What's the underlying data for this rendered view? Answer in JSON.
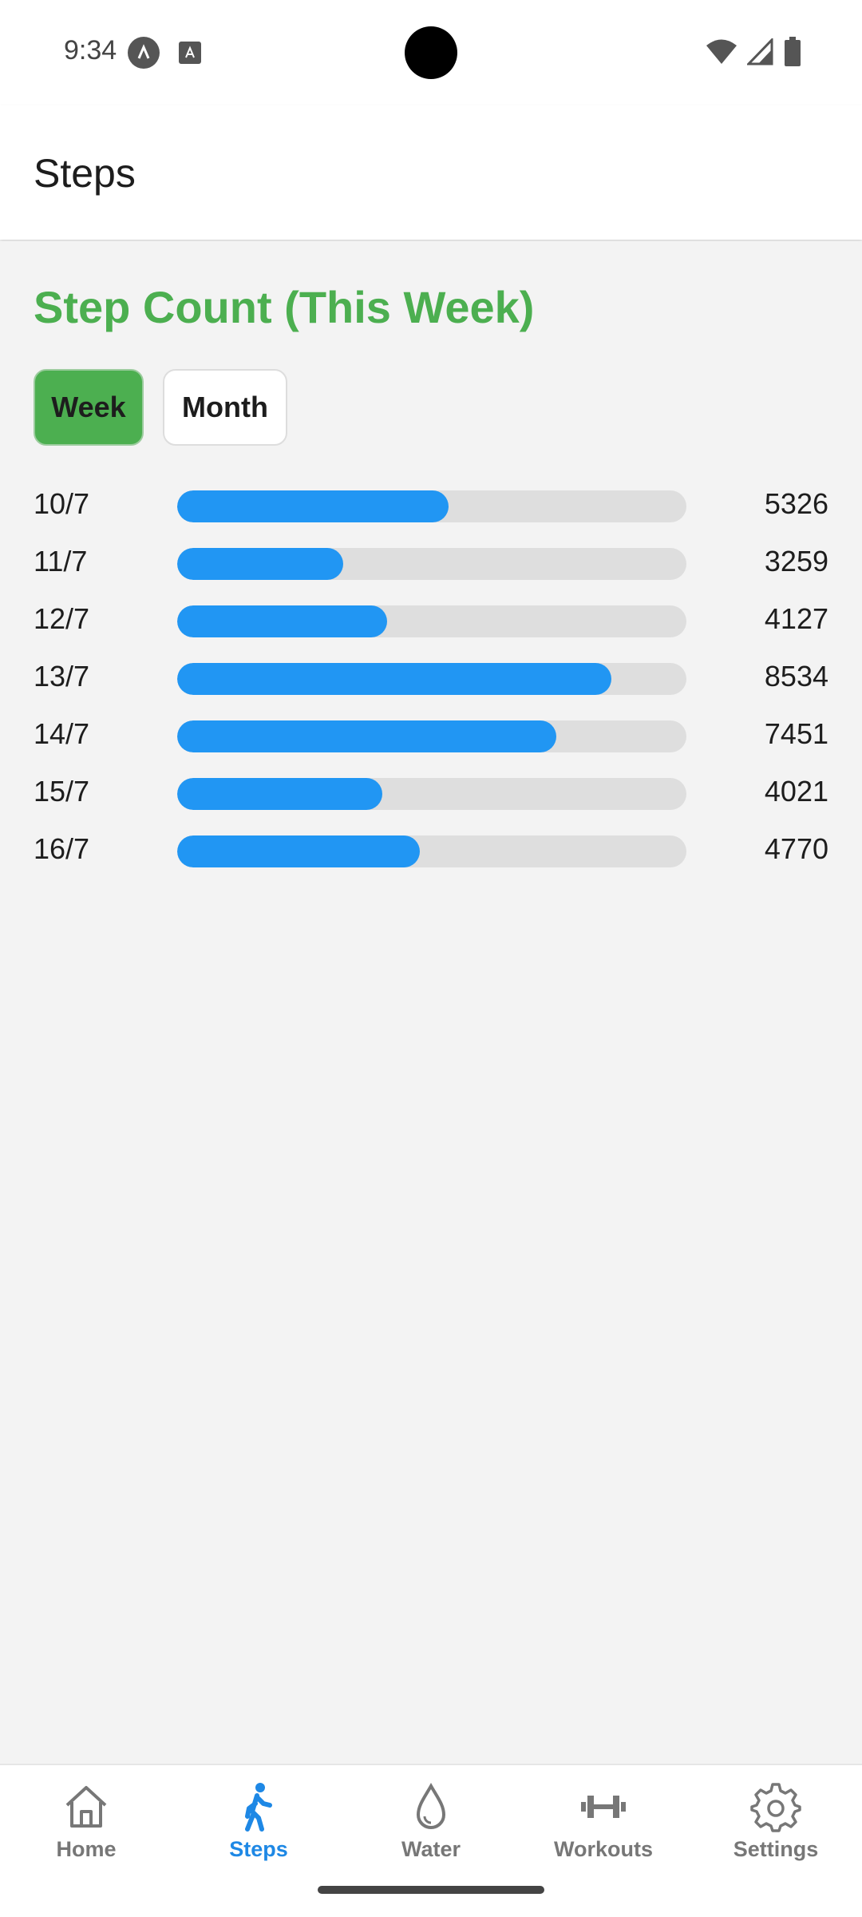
{
  "status_bar": {
    "time": "9:34"
  },
  "app_bar": {
    "title": "Steps"
  },
  "main": {
    "section_title": "Step Count (This Week)",
    "toggle": {
      "week_label": "Week",
      "month_label": "Month",
      "selected": "Week"
    },
    "colors": {
      "accent": "#4caf50",
      "bar_fill": "#2196f3",
      "bar_track": "#dedede"
    },
    "max_steps": 10000,
    "rows": [
      {
        "date": "10/7",
        "steps": "5326"
      },
      {
        "date": "11/7",
        "steps": "3259"
      },
      {
        "date": "12/7",
        "steps": "4127"
      },
      {
        "date": "13/7",
        "steps": "8534"
      },
      {
        "date": "14/7",
        "steps": "7451"
      },
      {
        "date": "15/7",
        "steps": "4021"
      },
      {
        "date": "16/7",
        "steps": "4770"
      }
    ]
  },
  "bottom_nav": {
    "items": [
      {
        "label": "Home",
        "icon": "home-icon"
      },
      {
        "label": "Steps",
        "icon": "walking-icon",
        "active": true
      },
      {
        "label": "Water",
        "icon": "water-drop-icon"
      },
      {
        "label": "Workouts",
        "icon": "dumbbell-icon"
      },
      {
        "label": "Settings",
        "icon": "gear-icon"
      }
    ]
  }
}
